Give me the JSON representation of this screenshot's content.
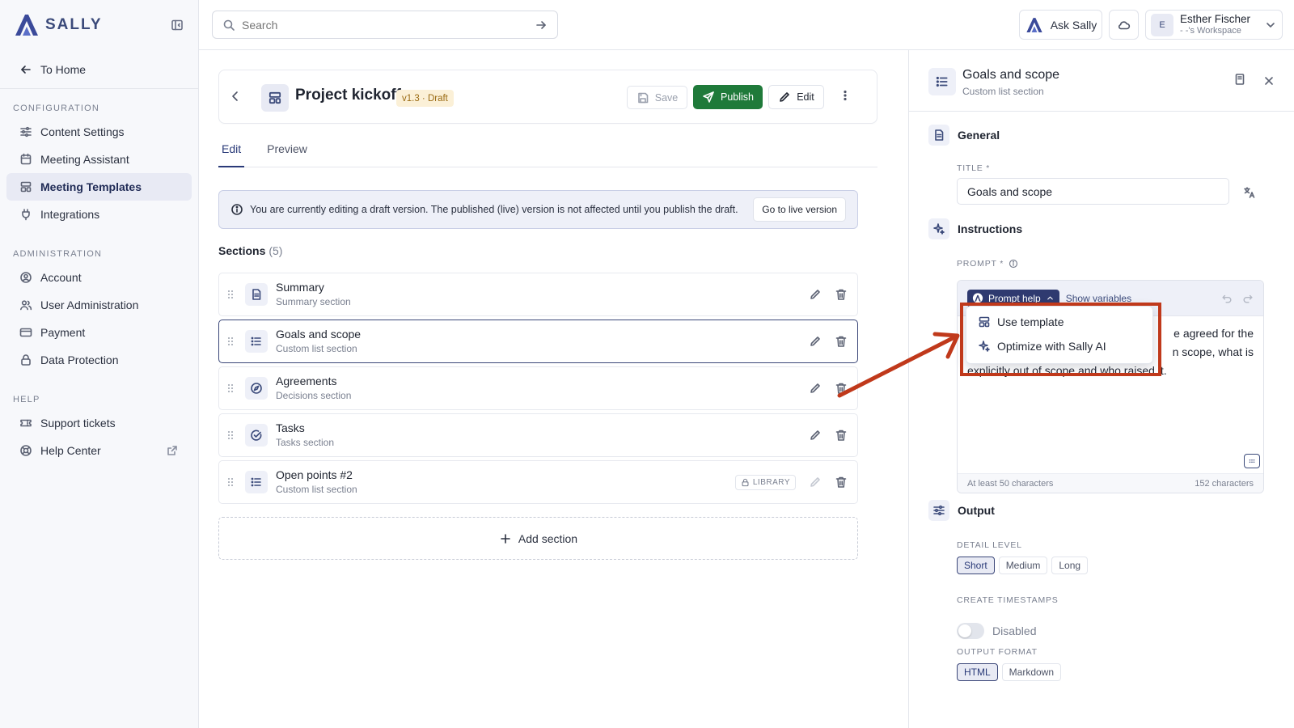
{
  "brand": {
    "name": "SALLY",
    "accent": "#2f3a70"
  },
  "sidebar": {
    "to_home": "To Home",
    "sections": [
      {
        "title": "CONFIGURATION",
        "items": [
          {
            "label": "Content Settings",
            "icon": "sliders-icon"
          },
          {
            "label": "Meeting Assistant",
            "icon": "calendar-icon"
          },
          {
            "label": "Meeting Templates",
            "icon": "template-icon",
            "active": true
          },
          {
            "label": "Integrations",
            "icon": "plug-icon"
          }
        ]
      },
      {
        "title": "ADMINISTRATION",
        "items": [
          {
            "label": "Account",
            "icon": "user-circle-icon"
          },
          {
            "label": "User Administration",
            "icon": "users-icon"
          },
          {
            "label": "Payment",
            "icon": "credit-card-icon"
          },
          {
            "label": "Data Protection",
            "icon": "lock-icon"
          }
        ]
      },
      {
        "title": "HELP",
        "items": [
          {
            "label": "Support tickets",
            "icon": "ticket-icon"
          },
          {
            "label": "Help Center",
            "icon": "lifebuoy-icon"
          }
        ]
      }
    ]
  },
  "topbar": {
    "search_placeholder": "Search",
    "ask_label": "Ask Sally",
    "user": {
      "initial": "E",
      "name": "Esther Fischer",
      "workspace": "- -'s Workspace"
    }
  },
  "template": {
    "title": "Project kickoff",
    "version": "v1.3 · Draft",
    "save_label": "Save",
    "publish_label": "Publish",
    "edit_label": "Edit",
    "publish_color": "#1f7a3a"
  },
  "tabs": [
    {
      "label": "Edit",
      "active": true
    },
    {
      "label": "Preview"
    }
  ],
  "draft_banner": {
    "text": "You are currently editing a draft version. The published (live) version is not affected until you publish the draft.",
    "button": "Go to live version"
  },
  "sections": {
    "title": "Sections",
    "count": "(5)",
    "items": [
      {
        "name": "Summary",
        "sub": "Summary section",
        "icon": "document-icon"
      },
      {
        "name": "Goals and scope",
        "sub": "Custom list section",
        "icon": "list-icon",
        "selected": true
      },
      {
        "name": "Agreements",
        "sub": "Decisions section",
        "icon": "compass-icon"
      },
      {
        "name": "Tasks",
        "sub": "Tasks section",
        "icon": "check-circle-icon"
      },
      {
        "name": "Open points #2",
        "sub": "Custom list section",
        "icon": "list-icon",
        "badge": "LIBRARY"
      }
    ],
    "add_label": "Add section"
  },
  "panel": {
    "title": "Goals and scope",
    "subtitle": "Custom list section",
    "general": {
      "heading": "General",
      "title_label": "TITLE *",
      "title_value": "Goals and scope"
    },
    "instructions": {
      "heading": "Instructions",
      "prompt_label": "PROMPT *",
      "prompt_help": "Prompt help",
      "show_variables": "Show variables",
      "prompt_text_line1": "e agreed for the",
      "prompt_text_line2": "n scope, what is",
      "prompt_text_line3": "explicitly out of scope and who raised it.",
      "min_chars": "At least 50 characters",
      "char_count": "152 characters",
      "dropdown": [
        {
          "label": "Use template",
          "icon": "template-icon"
        },
        {
          "label": "Optimize with Sally AI",
          "icon": "sparkle-icon"
        }
      ]
    },
    "output": {
      "heading": "Output",
      "detail_label": "DETAIL LEVEL",
      "detail_options": [
        "Short",
        "Medium",
        "Long"
      ],
      "detail_selected": "Short",
      "timestamps_label": "CREATE TIMESTAMPS",
      "timestamps_value": "Disabled",
      "format_label": "OUTPUT FORMAT",
      "format_options": [
        "HTML",
        "Markdown"
      ],
      "format_selected": "HTML"
    }
  },
  "annotation": {
    "color": "#c0391b"
  }
}
